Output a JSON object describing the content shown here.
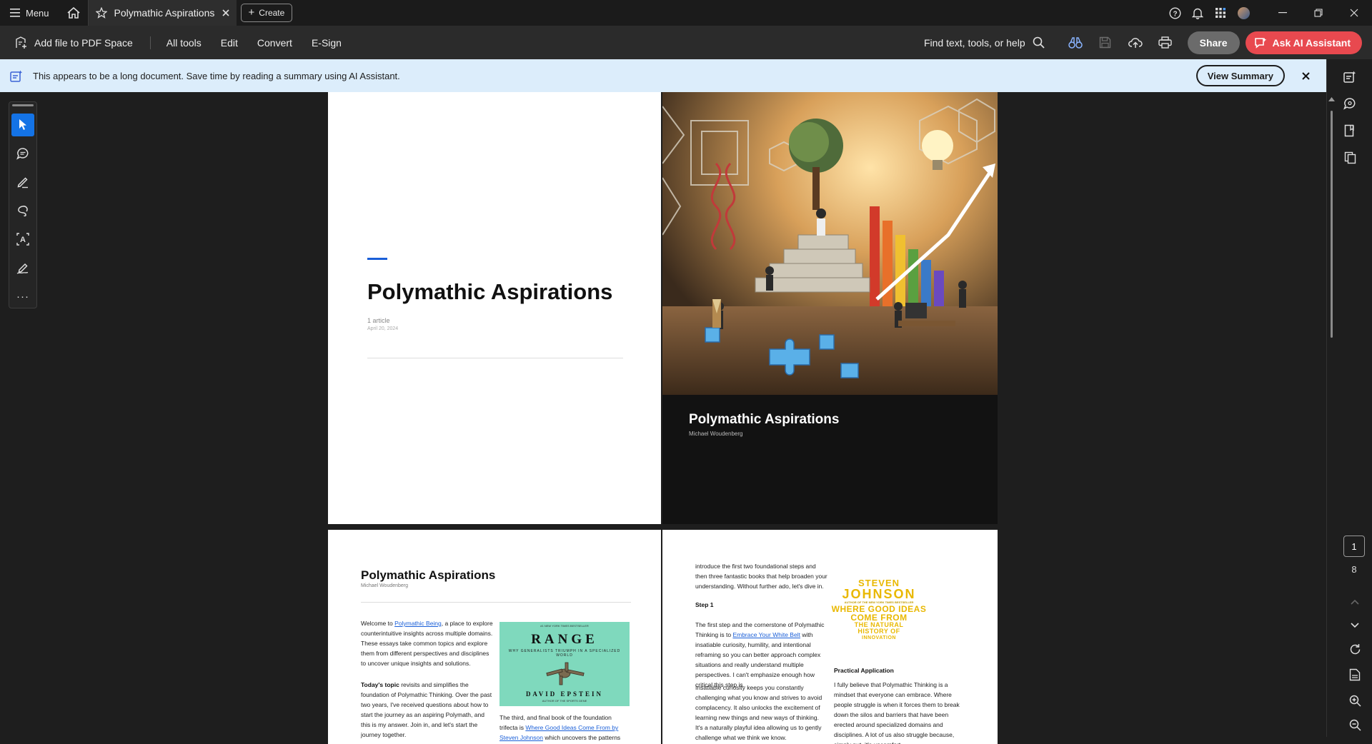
{
  "titlebar": {
    "menu_label": "Menu",
    "tab_title": "Polymathic Aspirations",
    "create_label": "Create"
  },
  "toolbar": {
    "add_file_label": "Add file to PDF Space",
    "menus": [
      "All tools",
      "Edit",
      "Convert",
      "E-Sign"
    ],
    "find_label": "Find text, tools, or help",
    "share_label": "Share",
    "ai_label": "Ask AI Assistant"
  },
  "banner": {
    "message": "This appears to be a long document. Save time by reading a summary using AI Assistant.",
    "button_label": "View Summary"
  },
  "navigation": {
    "current_page": "1",
    "total_pages": "8"
  },
  "document": {
    "page1": {
      "title": "Polymathic Aspirations",
      "article_count": "1 article",
      "date": "April 20, 2024"
    },
    "page2": {
      "title": "Polymathic Aspirations",
      "author": "Michael Woudenberg"
    },
    "page3": {
      "title": "Polymathic Aspirations",
      "author": "Michael Woudenberg",
      "para1_a": "Welcome to ",
      "para1_link": "Polymathic Being",
      "para1_b": ", a place to explore counterintuitive insights across multiple domains. These essays take common topics and explore them from different perspectives and disciplines to uncover unique insights and solutions.",
      "para2_bold": "Today's topic",
      "para2_b": " revisits and simplifies the foundation of Polymathic Thinking. Over the past two years, I've received questions about how to start the journey as an aspiring Polymath, and this is my answer. Join in, and let's start the journey together.",
      "para3_a": "The third, and final book of the foundation trifecta is ",
      "para3_link": "Where Good Ideas Come From by Steven Johnson",
      "para3_b": " which uncovers the patterns and envi-",
      "book": {
        "kicker": "#1 NEW YORK TIMES BESTSELLER",
        "title": "RANGE",
        "subtitle": "WHY GENERALISTS TRIUMPH IN A SPECIALIZED WORLD",
        "author": "DAVID EPSTEIN",
        "author_note": "AUTHOR OF THE SPORTS GENE"
      }
    },
    "page4": {
      "intro": "introduce the first two foundational steps and then three fantastic books that help broaden your understanding. Without further ado, let's dive in.",
      "step_heading": "Step 1",
      "step_a": "The first step and the cornerstone of Polymathic Thinking is to ",
      "step_link": "Embrace Your White Belt",
      "step_b": " with insatiable curiosity, humility, and intentional reframing so you can better approach complex situations and really understand multiple perspectives. I can't emphasize enough how critical this step is.",
      "curiosity": "Insatiable curiosity keeps you constantly challenging what you know and strives to avoid complacency. It also unlocks the excitement of learning new things and new ways of thinking. It's a naturally playful idea allowing us to gently challenge what we think we know.",
      "practical_heading": "Practical Application",
      "practical": "I fully believe that Polymathic Thinking is a mindset that everyone can embrace. Where people struggle is when it forces them to break down the silos and barriers that have been erected around specialized domains and disciplines. A lot of us also struggle because, simply put, it's uncomfort-",
      "book": {
        "author_first": "STEVEN",
        "author_last": "JOHNSON",
        "tagline": "AUTHOR OF THE NEW YORK TIMES BESTSELLER",
        "title": "WHERE GOOD IDEAS COME FROM",
        "subtitle1": "THE NATURAL",
        "subtitle2": "HISTORY OF",
        "subtitle3": "INNOVATION"
      }
    }
  }
}
